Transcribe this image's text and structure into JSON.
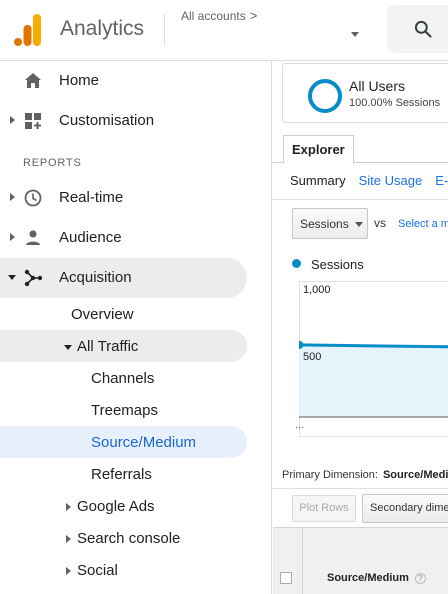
{
  "header": {
    "brand": "Analytics",
    "accounts_label": "All accounts",
    "accounts_chevron": ">",
    "icons": [
      "analytics-logo-icon",
      "chevron-right-icon",
      "caret-down-icon",
      "search-icon"
    ]
  },
  "sidebar": {
    "home": "Home",
    "customisation": "Customisation",
    "reports_heading": "REPORTS",
    "realtime": "Real-time",
    "audience": "Audience",
    "acquisition": "Acquisition",
    "overview": "Overview",
    "all_traffic": "All Traffic",
    "channels": "Channels",
    "treemaps": "Treemaps",
    "source_medium": "Source/Medium",
    "referrals": "Referrals",
    "google_ads": "Google Ads",
    "search_console": "Search console",
    "social": "Social"
  },
  "main": {
    "segment": {
      "name": "All Users",
      "subtitle": "100.00% Sessions"
    },
    "tab_explorer": "Explorer",
    "subtabs": {
      "summary": "Summary",
      "site_usage": "Site Usage",
      "ecommerce": "E-"
    },
    "metric_select": "Sessions",
    "vs": "vs",
    "select_metric": "Select a m",
    "legend_series": "Sessions",
    "primary_dimension_label": "Primary Dimension:",
    "primary_dimension_value": "Source/Medi",
    "plot_rows": "Plot Rows",
    "secondary_dimension": "Secondary dime",
    "column_source_medium": "Source/Medium",
    "help_glyph": "?"
  },
  "chart_data": {
    "type": "area",
    "series": [
      {
        "name": "Sessions",
        "values": [
          530
        ]
      }
    ],
    "yticks": [
      "1,000",
      "500"
    ],
    "x_tick_text": "...",
    "ylim": [
      0,
      1000
    ],
    "grid": true,
    "series_color": "#058dc7"
  },
  "colors": {
    "accent": "#058dc7",
    "link": "#1a73e8",
    "selected_bg": "#e8f0fe",
    "selected_text": "#1967d2",
    "logo_orange": "#f9ab00",
    "logo_dark_orange": "#e37400"
  }
}
